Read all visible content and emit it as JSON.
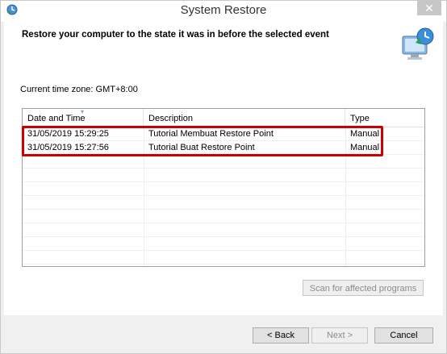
{
  "window": {
    "title": "System Restore",
    "close_glyph": "✕"
  },
  "header": {
    "instruction": "Restore your computer to the state it was in before the selected event",
    "icon": "system-restore-icon"
  },
  "timezone": {
    "label": "Current time zone: GMT+8:00"
  },
  "table": {
    "columns": [
      "Date and Time",
      "Description",
      "Type"
    ],
    "rows": [
      {
        "datetime": "31/05/2019 15:29:25",
        "description": "Tutorial Membuat Restore Point",
        "type": "Manual"
      },
      {
        "datetime": "31/05/2019 15:27:56",
        "description": "Tutorial Buat Restore Point",
        "type": "Manual"
      }
    ]
  },
  "buttons": {
    "scan": "Scan for affected programs",
    "back": "< Back",
    "next": "Next >",
    "cancel": "Cancel"
  },
  "colors": {
    "highlight": "#cc0000",
    "window_bg": "#f0f0f0"
  }
}
